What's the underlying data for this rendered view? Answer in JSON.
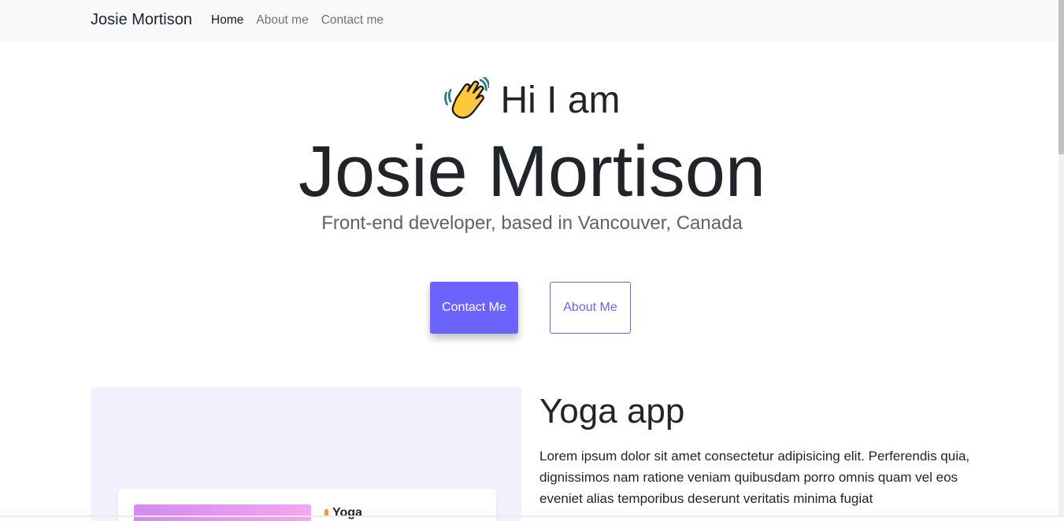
{
  "navbar": {
    "brand": "Josie Mortison",
    "items": [
      {
        "label": "Home",
        "active": true
      },
      {
        "label": "About me",
        "active": false
      },
      {
        "label": "Contact me",
        "active": false
      }
    ]
  },
  "hero": {
    "greeting": "Hi I am",
    "greeting_icon": "waving-hand-icon",
    "name": "Josie Mortison",
    "subtitle": "Front-end developer, based in Vancouver, Canada",
    "primary_button": "Contact Me",
    "secondary_button": "About Me"
  },
  "project": {
    "title": "Yoga app",
    "description": "Lorem ipsum dolor sit amet consectetur adipisicing elit. Perferendis quia, dignissimos nam ratione veniam quibusdam porro omnis quam vel eos eveniet alias temporibus deserunt veritatis minima fugiat",
    "preview_label": "Yoga"
  },
  "colors": {
    "accent": "#6c63ff",
    "navbar_bg": "#f8f9fa",
    "project_bg": "#f3f0fd"
  }
}
